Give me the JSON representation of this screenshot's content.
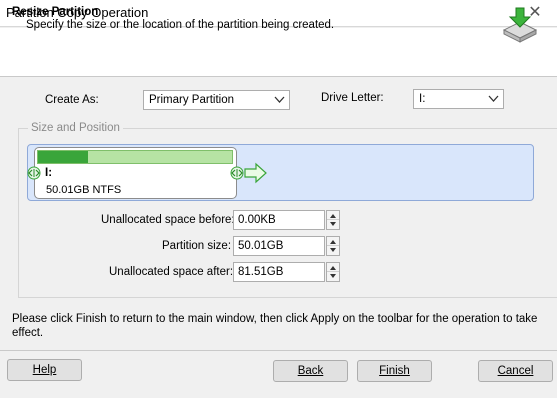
{
  "window": {
    "title": "Partition Copy Operation",
    "close_glyph": "✕"
  },
  "header": {
    "title": "Resize Partition",
    "subtitle": "Specify the size or the location of the partition being created.",
    "icon": "disk-copy-icon"
  },
  "form": {
    "create_as_label": "Create As:",
    "create_as_value": "Primary Partition",
    "drive_letter_label": "Drive Letter:",
    "drive_letter_value": "I:"
  },
  "size_position": {
    "group_title": "Size and Position",
    "partition": {
      "letter": "I:",
      "info": "50.01GB NTFS",
      "used_fraction": 0.26
    },
    "fields": [
      {
        "label": "Unallocated space before:",
        "value": "0.00KB"
      },
      {
        "label": "Partition size:",
        "value": "50.01GB"
      },
      {
        "label": "Unallocated space after:",
        "value": "81.51GB"
      }
    ]
  },
  "hint": "Please click Finish to return to the main window, then click Apply on the toolbar for the operation to take effect.",
  "buttons": {
    "help": "Help",
    "back": "Back",
    "finish": "Finish",
    "cancel": "Cancel"
  },
  "colors": {
    "usage_fill": "#3aa53a",
    "usage_free": "#b6e3a4",
    "disk_map_bg": "#d9e6fb"
  }
}
